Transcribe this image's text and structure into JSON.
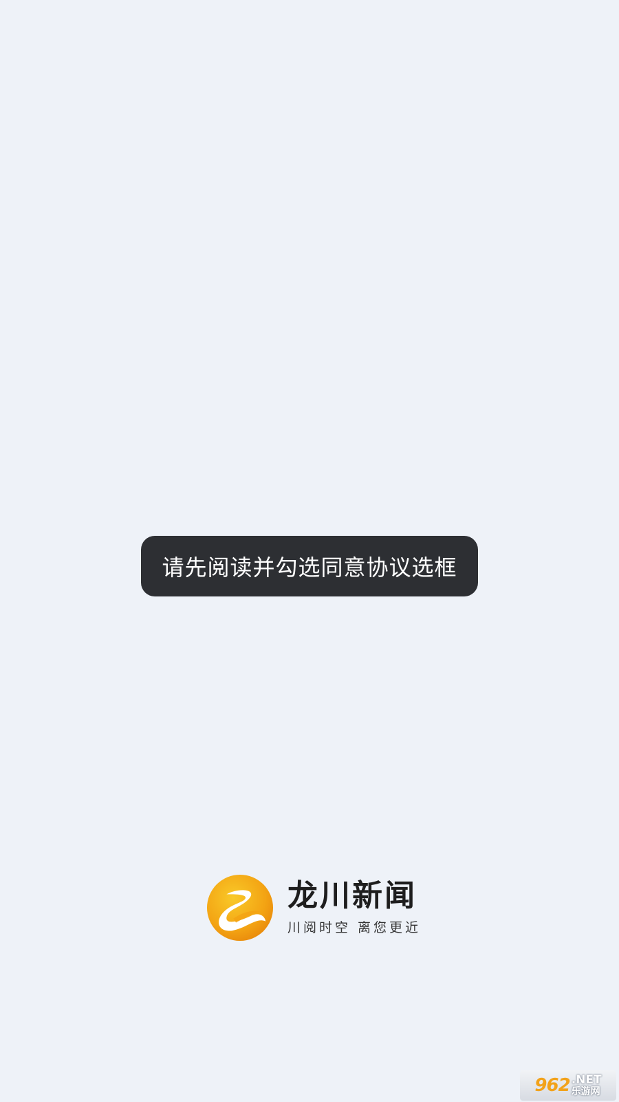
{
  "toast": {
    "message": "请先阅读并勾选同意协议选框"
  },
  "brand": {
    "title": "龙川新闻",
    "slogan": "川阅时空  离您更近",
    "logo_icon": "longchuan-news-logo-icon"
  },
  "watermark": {
    "number": "962",
    "net": ".NET",
    "cn": "乐游网"
  },
  "colors": {
    "background": "#eef2f8",
    "toast_bg": "#2d2f33",
    "toast_text": "#ffffff",
    "logo_orange": "#f39a12",
    "logo_gold": "#f7c21d"
  }
}
